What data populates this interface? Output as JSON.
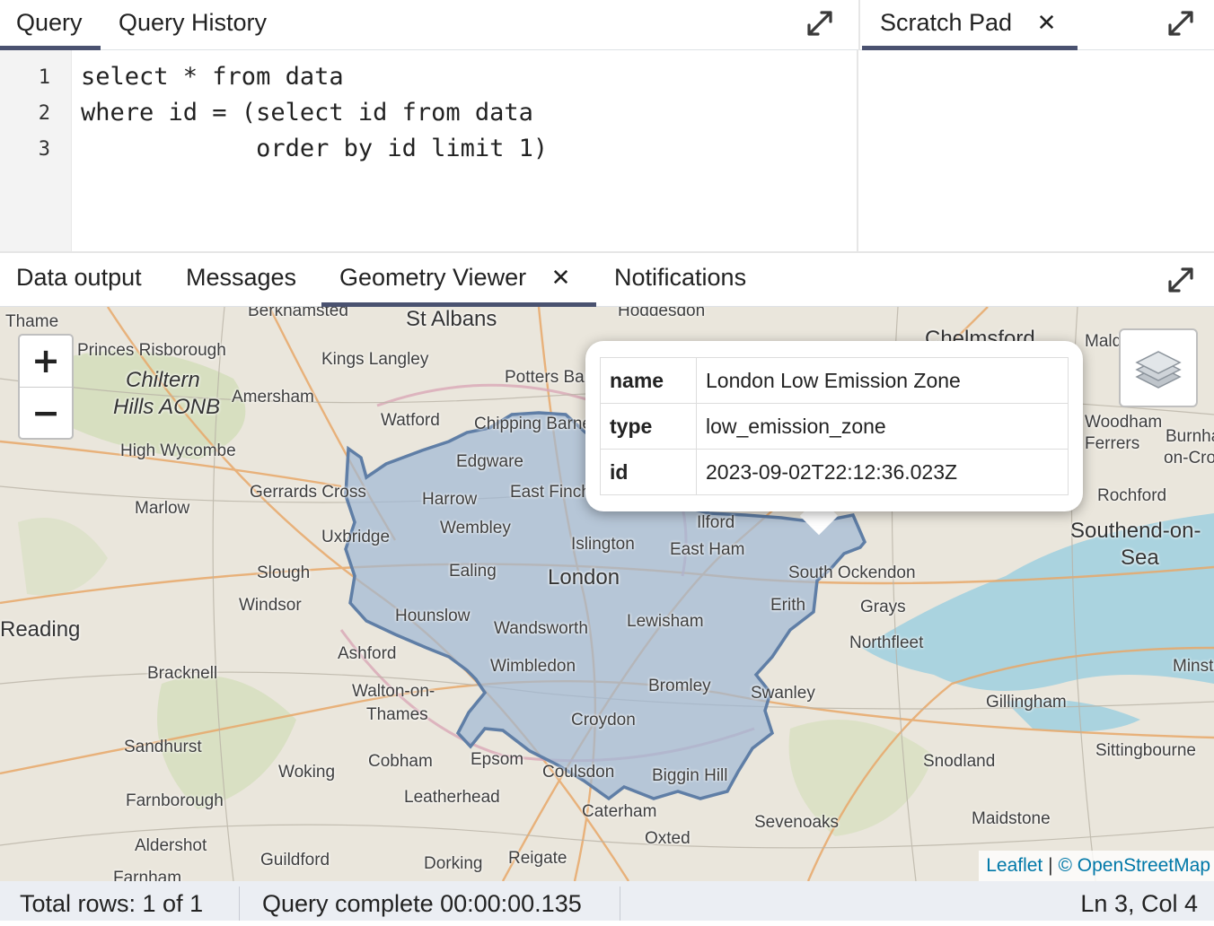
{
  "query_panel": {
    "tabs": [
      {
        "label": "Query",
        "active": true
      },
      {
        "label": "Query History",
        "active": false
      }
    ]
  },
  "editor": {
    "line_numbers": [
      "1",
      "2",
      "3"
    ],
    "lines": [
      "select * from data",
      "where id = (select id from data",
      "            order by id limit 1)"
    ]
  },
  "scratch_pad": {
    "tab_label": "Scratch Pad",
    "close_glyph": "✕"
  },
  "results": {
    "tabs": [
      {
        "label": "Data output",
        "active": false
      },
      {
        "label": "Messages",
        "active": false
      },
      {
        "label": "Geometry Viewer",
        "active": true,
        "close_glyph": "✕"
      },
      {
        "label": "Notifications",
        "active": false
      }
    ]
  },
  "map": {
    "zoom_in": "+",
    "zoom_out": "−",
    "popup": {
      "rows": [
        {
          "key": "name",
          "value": "London Low Emission Zone"
        },
        {
          "key": "type",
          "value": "low_emission_zone"
        },
        {
          "key": "id",
          "value": "2023-09-02T22:12:36.023Z"
        }
      ]
    },
    "attribution": {
      "leaflet": "Leaflet",
      "separator": "|",
      "osm": "© OpenStreetMap"
    },
    "labels": [
      "Thame",
      "Berkhamsted",
      "St Albans",
      "Hoddesdon",
      "Chelmsford",
      "Maldon",
      "Princes Risborough",
      "Kings Langley",
      "Chiltern",
      "Hills AONB",
      "Amersham",
      "Potters Bar",
      "Watford",
      "Chipping Barnet",
      "High Wycombe",
      "Edgware",
      "Gerrards Cross",
      "Harrow",
      "East Finchley",
      "Marlow",
      "Wembley",
      "Uxbridge",
      "Islington",
      "Ilford",
      "East Ham",
      "Slough",
      "Ealing",
      "London",
      "South Ockendon",
      "Windsor",
      "Reading",
      "Hounslow",
      "Wandsworth",
      "Lewisham",
      "Erith",
      "Grays",
      "Ashford",
      "Northfleet",
      "Bracknell",
      "Wimbledon",
      "Walton-on-",
      "Thames",
      "Bromley",
      "Swanley",
      "Gillingham",
      "Croydon",
      "Sandhurst",
      "Woking",
      "Cobham",
      "Epsom",
      "Coulsdon",
      "Biggin Hill",
      "Snodland",
      "Sittingbourne",
      "Farnborough",
      "Leatherhead",
      "Caterham",
      "Sevenoaks",
      "Maidstone",
      "Oxted",
      "Aldershot",
      "Guildford",
      "Dorking",
      "Reigate",
      "Rochford",
      "Southend-on-",
      "Sea",
      "Woodham",
      "Ferrers",
      "Burnham-",
      "on-Crouch",
      "Minster",
      "Farnham"
    ],
    "boundary_color": "#5f7ea6",
    "fill_color": "#9fb8d4"
  },
  "statusbar": {
    "total_rows": "Total rows: 1 of 1",
    "query_status": "Query complete 00:00:00.135",
    "cursor_pos": "Ln 3, Col 4"
  },
  "colors": {
    "active_tab_underline": "#4a5270",
    "statusbar_bg": "#ebeef3",
    "gutter_bg": "#f3f3f3",
    "link": "#0078a8"
  }
}
